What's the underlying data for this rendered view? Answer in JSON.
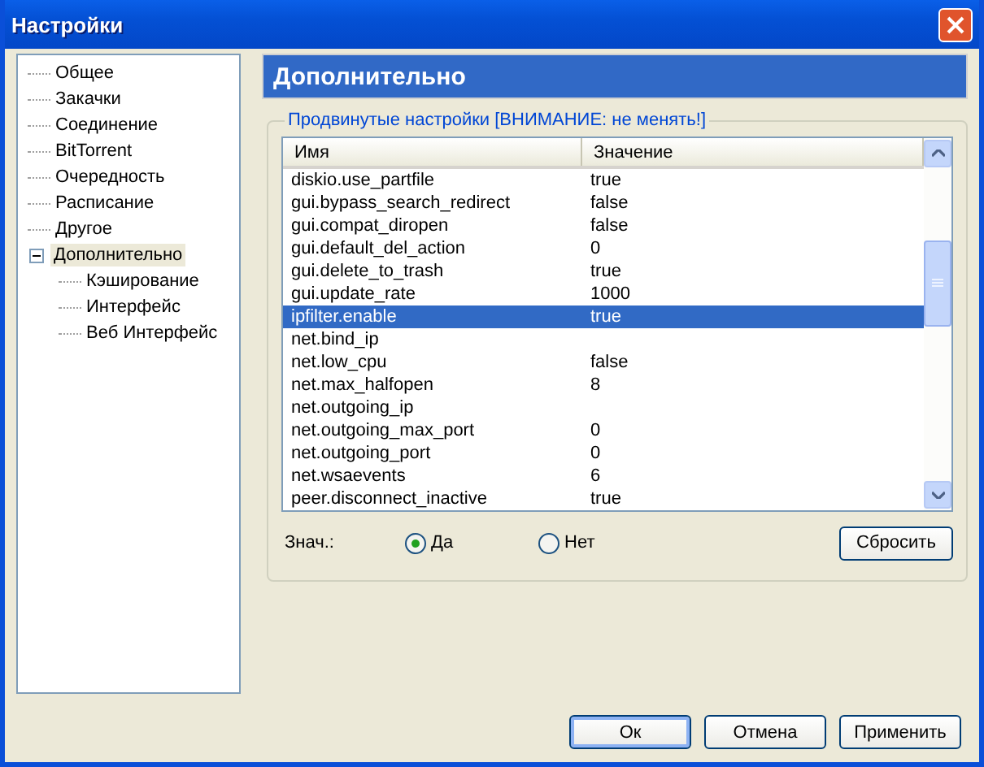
{
  "window": {
    "title": "Настройки"
  },
  "tree": {
    "items": [
      {
        "label": "Общее",
        "selected": false
      },
      {
        "label": "Закачки",
        "selected": false
      },
      {
        "label": "Соединение",
        "selected": false
      },
      {
        "label": "BitTorrent",
        "selected": false
      },
      {
        "label": "Очередность",
        "selected": false
      },
      {
        "label": "Расписание",
        "selected": false
      },
      {
        "label": "Другое",
        "selected": false
      },
      {
        "label": "Дополнительно",
        "selected": true,
        "expanded": true,
        "children": [
          {
            "label": "Кэширование",
            "selected": false
          },
          {
            "label": "Интерфейс",
            "selected": false
          },
          {
            "label": "Веб Интерфейс",
            "selected": false
          }
        ]
      }
    ]
  },
  "page_title": "Дополнительно",
  "group": {
    "title": "Продвинутые настройки [ВНИМАНИЕ: не менять!]"
  },
  "table": {
    "columns": [
      "Имя",
      "Значение"
    ],
    "rows": [
      {
        "name": "diskio.use_partfile",
        "value": "true",
        "selected": false
      },
      {
        "name": "gui.bypass_search_redirect",
        "value": "false",
        "selected": false
      },
      {
        "name": "gui.compat_diropen",
        "value": "false",
        "selected": false
      },
      {
        "name": "gui.default_del_action",
        "value": "0",
        "selected": false
      },
      {
        "name": "gui.delete_to_trash",
        "value": "true",
        "selected": false
      },
      {
        "name": "gui.update_rate",
        "value": "1000",
        "selected": false
      },
      {
        "name": "ipfilter.enable",
        "value": "true",
        "selected": true
      },
      {
        "name": "net.bind_ip",
        "selected": false
      },
      {
        "name": "net.low_cpu",
        "value": "false",
        "selected": false
      },
      {
        "name": "net.max_halfopen",
        "value": "8",
        "selected": false
      },
      {
        "name": "net.outgoing_ip",
        "selected": false
      },
      {
        "name": "net.outgoing_max_port",
        "value": "0",
        "selected": false
      },
      {
        "name": "net.outgoing_port",
        "value": "0",
        "selected": false
      },
      {
        "name": "net.wsaevents",
        "value": "6",
        "selected": false
      },
      {
        "name": "peer.disconnect_inactive",
        "value": "true",
        "selected": false
      }
    ]
  },
  "value_choice": {
    "label": "Знач.:",
    "options": [
      {
        "label": "Да",
        "selected": true
      },
      {
        "label": "Нет",
        "selected": false
      }
    ]
  },
  "reset_button": "Сбросить",
  "buttons": [
    {
      "label": "Ок",
      "default": true
    },
    {
      "label": "Отмена",
      "default": false
    },
    {
      "label": "Применить",
      "default": false
    }
  ]
}
